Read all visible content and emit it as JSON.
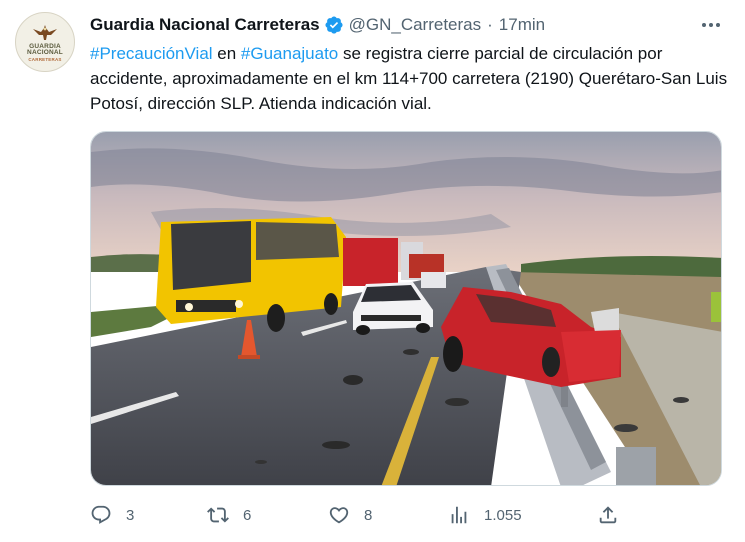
{
  "tweet": {
    "author": {
      "name": "Guardia Nacional Carreteras",
      "handle": "@GN_Carreteras",
      "verified": true,
      "avatar_lines": [
        "GUARDIA",
        "NACIONAL",
        "CARRETERAS"
      ]
    },
    "separator": "·",
    "time": "17min",
    "text": {
      "hashtag1": "#PrecauciónVial",
      "seg1": " en ",
      "hashtag2": "#Guanajuato",
      "seg2": " se registra cierre parcial de circulación por accidente, aproximadamente en el km 114+700 carretera (2190) Querétaro-San Luis Potosí, dirección SLP. Atienda indicación vial."
    },
    "actions": {
      "replies": "3",
      "retweets": "6",
      "likes": "8",
      "views": "1.055"
    }
  },
  "colors": {
    "hashtag": "#1d9bf0",
    "verified": "#1d9bf0",
    "secondary_text": "#536471",
    "bus_yellow": "#f2c400",
    "car_red": "#c8232a"
  },
  "icons": [
    "verified-badge-icon",
    "more-options-icon",
    "reply-icon",
    "retweet-icon",
    "like-icon",
    "views-icon",
    "share-icon",
    "eagle-logo-icon"
  ]
}
